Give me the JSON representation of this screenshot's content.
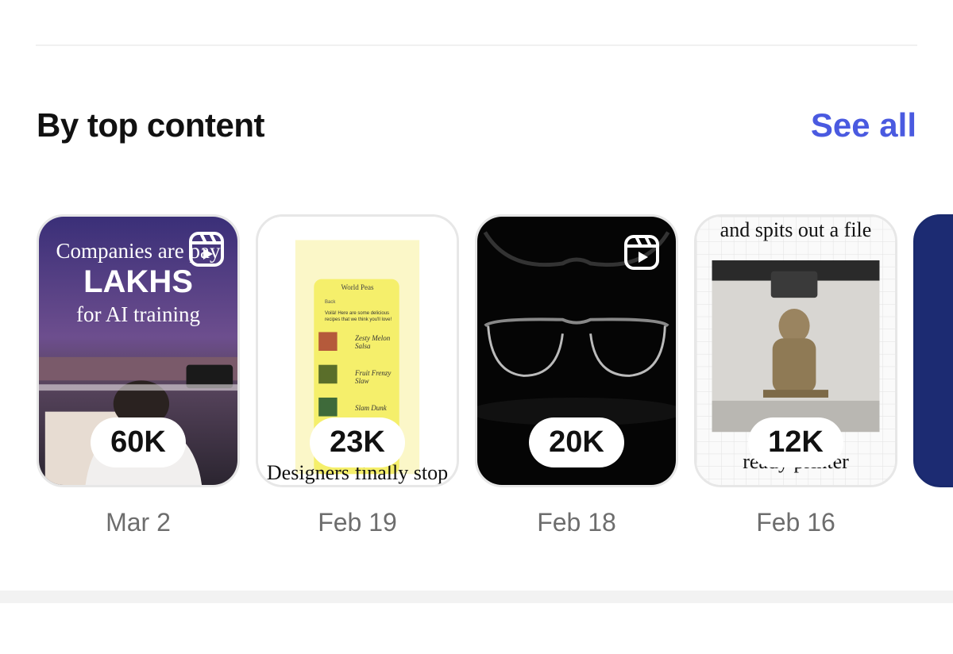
{
  "section": {
    "title": "By top content",
    "see_all": "See all"
  },
  "cards": [
    {
      "views": "60K",
      "date": "Mar 2",
      "overlay_lines": [
        "Companies are pay",
        "LAKHS",
        "for AI training"
      ],
      "type_icon": "reel-icon"
    },
    {
      "views": "23K",
      "date": "Feb 19",
      "app_title": "World Peas",
      "app_back": "Back",
      "app_intro": "Voilà! Here are some delicious recipes that we think you'll love!",
      "recipes": [
        "Zesty Melon Salsa",
        "Fruit Frenzy Slaw",
        "Slam Dunk"
      ],
      "caption": "Designers finally stop"
    },
    {
      "views": "20K",
      "date": "Feb 18",
      "type_icon": "reel-icon"
    },
    {
      "views": "12K",
      "date": "Feb 16",
      "top_caption": "and spits out a file",
      "bottom_caption": "ready printer"
    }
  ]
}
